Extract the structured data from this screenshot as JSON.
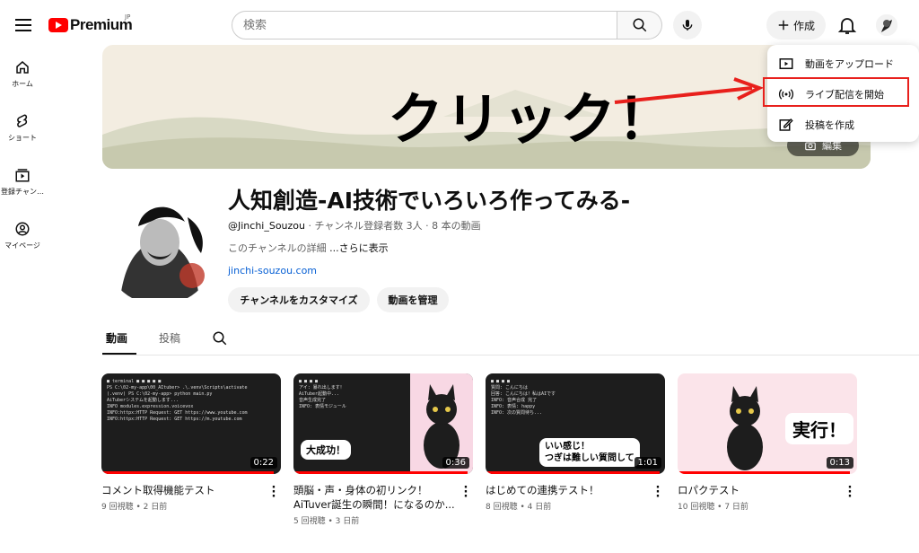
{
  "header": {
    "logo_text": "Premium",
    "logo_sup": "JP",
    "search_placeholder": "検索",
    "create_label": "作成"
  },
  "sidebar": [
    {
      "label": "ホーム",
      "icon": "home-icon"
    },
    {
      "label": "ショート",
      "icon": "shorts-icon"
    },
    {
      "label": "登録チャン…",
      "icon": "subscriptions-icon"
    },
    {
      "label": "マイページ",
      "icon": "you-icon"
    }
  ],
  "banner": {
    "text": "クリック！",
    "edit_label": "編集"
  },
  "create_menu": {
    "items": [
      {
        "label": "動画をアップロード",
        "icon": "upload-video-icon"
      },
      {
        "label": "ライブ配信を開始",
        "icon": "live-icon"
      },
      {
        "label": "投稿を作成",
        "icon": "post-edit-icon"
      }
    ]
  },
  "channel": {
    "name": "人知創造-AI技術でいろいろ作ってみる-",
    "handle": "@Jinchi_Souzou",
    "meta": " ‧ チャンネル登録者数 3人 ‧ 8 本の動画",
    "desc": "このチャンネルの詳細 ",
    "more": "...さらに表示",
    "link": "jinchi-souzou.com",
    "customize_label": "チャンネルをカスタマイズ",
    "manage_label": "動画を管理"
  },
  "tabs": [
    "動画",
    "投稿"
  ],
  "videos": [
    {
      "title": "コメント取得機能テスト",
      "meta": "9 回視聴 • 2 日前",
      "duration": "0:22",
      "progress": 0.96
    },
    {
      "title": "頭脳・声・身体の初リンク！AiTuver誕生の瞬間！になるのか...",
      "meta": "5 回視聴 • 3 日前",
      "duration": "0:36",
      "progress": 0.97,
      "overlay": "大成功！"
    },
    {
      "title": "はじめての連携テスト！",
      "meta": "8 回視聴 • 4 日前",
      "duration": "1:01",
      "progress": 0.97,
      "overlay": "いい感じ！\nつぎは難しい質問して"
    },
    {
      "title": "ロパクテスト",
      "meta": "10 回視聴 • 7 日前",
      "duration": "0:13",
      "progress": 0.96,
      "overlay": "実行！"
    }
  ],
  "colors": {
    "accent": "#ff0000",
    "highlight": "#e8201c",
    "link": "#065fd4"
  }
}
